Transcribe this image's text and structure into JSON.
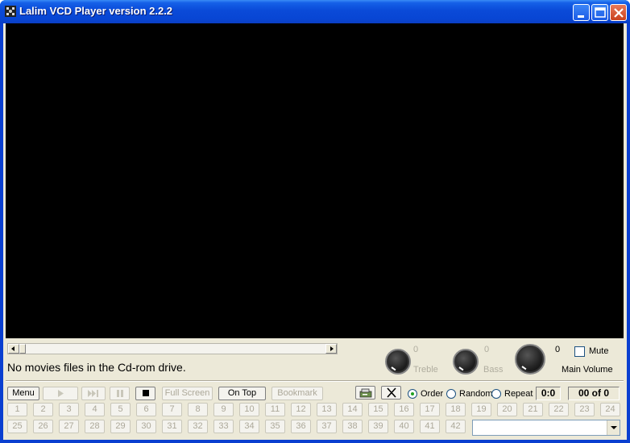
{
  "window": {
    "title": "Lalim VCD Player version 2.2.2",
    "icons": [
      "app-icon",
      "minimize-icon",
      "maximize-icon",
      "close-icon"
    ]
  },
  "status": {
    "message": "No movies files in the Cd-rom drive."
  },
  "audio": {
    "treble_value": "0",
    "treble_label": "Treble",
    "bass_value": "0",
    "bass_label": "Bass",
    "volume_value": "0",
    "volume_label": "Main Volume",
    "mute_label": "Mute",
    "mute_checked": false
  },
  "controls": {
    "menu": "Menu",
    "play_icon": "play-icon",
    "next_icon": "skip-forward-icon",
    "pause_icon": "pause-icon",
    "stop_icon": "stop-icon",
    "full_screen": "Full Screen",
    "on_top": "On Top",
    "bookmark": "Bookmark",
    "eject_icon": "eject-icon",
    "clear_icon": "clear-x-icon",
    "order": "Order",
    "random": "Random",
    "repeat": "Repeat",
    "selected_mode": "Order",
    "time": "0:0",
    "track_counter": "00 of 0"
  },
  "tracks": {
    "row1": [
      "1",
      "2",
      "3",
      "4",
      "5",
      "6",
      "7",
      "8",
      "9",
      "10",
      "11",
      "12",
      "13",
      "14",
      "15",
      "16",
      "17",
      "18",
      "19",
      "20",
      "21",
      "22",
      "23",
      "24"
    ],
    "row2": [
      "25",
      "26",
      "27",
      "28",
      "29",
      "30",
      "31",
      "32",
      "33",
      "34",
      "35",
      "36",
      "37",
      "38",
      "39",
      "40",
      "41",
      "42"
    ]
  },
  "colors": {
    "titlebar": "#0a4ad8",
    "face": "#ece9d8",
    "video": "#000000",
    "disabled_text": "#aca899"
  }
}
